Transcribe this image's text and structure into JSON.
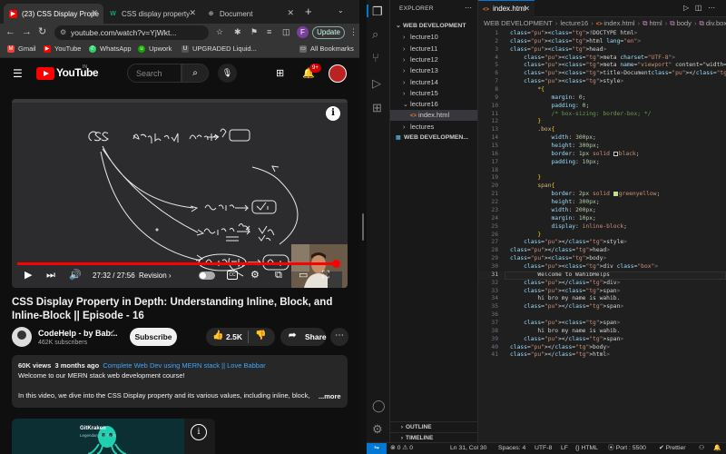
{
  "browser": {
    "tabs": [
      {
        "title": "(23) CSS Display Prope",
        "favicon": "youtube-icon",
        "active": true
      },
      {
        "title": "CSS display property",
        "favicon": "w3schools-icon",
        "active": false
      },
      {
        "title": "Document",
        "favicon": "globe-icon",
        "active": false
      }
    ],
    "url": "youtube.com/watch?v=YjWkt...",
    "update_label": "Update",
    "profile_initial": "F",
    "bookmarks": [
      "Gmail",
      "YouTube",
      "WhatsApp",
      "Upwork",
      "UPGRADED Liquid...",
      "All Bookmarks"
    ]
  },
  "youtube": {
    "logo": "YouTube",
    "region": "IN",
    "search_placeholder": "Search",
    "notification_count": "9+",
    "video": {
      "time": "27:32 / 27:56",
      "chapter": "Revision ›",
      "progress": 0.985
    },
    "title": "CSS Display Property in Depth: Understanding Inline, Block, and Inline-Block || Episode - 16",
    "channel": "CodeHelp - by Bab...",
    "subscribers": "462K subscribers",
    "subscribe_label": "Subscribe",
    "likes": "2.5K",
    "share_label": "Share",
    "description": {
      "views": "60K views",
      "age": "3 months ago",
      "playlist": "Complete Web Dev using MERN stack || Love Babbar",
      "line1": "Welcome to our MERN stack web development course!",
      "line2": "In this video, we dive into the CSS Display property and its various values, including inline, block,",
      "more": "...more"
    },
    "ad": {
      "brand": "GitKraken",
      "tagline": "Legendary Git Tools"
    }
  },
  "vscode": {
    "explorer_title": "EXPLORER",
    "workspace": "WEB DEVELOPMENT",
    "tree": [
      {
        "label": "WEB DEVELOPMENT",
        "type": "folder-open",
        "indent": 0
      },
      {
        "label": "lecture10",
        "type": "folder",
        "indent": 1
      },
      {
        "label": "lecture11",
        "type": "folder",
        "indent": 1
      },
      {
        "label": "lecture12",
        "type": "folder",
        "indent": 1
      },
      {
        "label": "lecture13",
        "type": "folder",
        "indent": 1
      },
      {
        "label": "lecture14",
        "type": "folder",
        "indent": 1
      },
      {
        "label": "lecture15",
        "type": "folder",
        "indent": 1
      },
      {
        "label": "lecture16",
        "type": "folder-open",
        "indent": 1
      },
      {
        "label": "index.html",
        "type": "html-file",
        "indent": 2,
        "selected": true
      },
      {
        "label": "lectures",
        "type": "folder",
        "indent": 1
      },
      {
        "label": "WEB DEVELOPMEN...",
        "type": "workspace-file",
        "indent": 0
      }
    ],
    "outline_label": "OUTLINE",
    "timeline_label": "TIMELINE",
    "tab": "index.html",
    "breadcrumbs": [
      "WEB DEVELOPMENT",
      "lecture16",
      "index.html",
      "html",
      "body",
      "div.box"
    ],
    "cursor_line": 31,
    "code": [
      "<!DOCTYPE html>",
      "<html lang=\"en\">",
      "<head>",
      "    <meta charset=\"UTF-8\">",
      "    <meta name=\"viewport\" content=\"width=device-width",
      "    <title>Document</title>",
      "    <style>",
      "        *{",
      "            margin: 0;",
      "            padding: 0;",
      "            /* box-sizing: border-box; */",
      "        }",
      "        .box{",
      "            width: 300px;",
      "            height: 300px;",
      "            border: 1px solid black;",
      "            padding: 10px;",
      "",
      "        }",
      "        span{",
      "            border: 2px solid greenyellow;",
      "            height: 300px;",
      "            width: 200px;",
      "            margin: 10px;",
      "            display: inline-block;",
      "        }",
      "    </style>",
      "</head>",
      "<body>",
      "    <div class=\"box\">",
      "        Welcome to WahibHelps",
      "    </div>",
      "    <span>",
      "        hi bro my name is wahib.",
      "    </span>",
      "",
      "    <span>",
      "        hi bro my name is wahib.",
      "    </span>",
      "</body>",
      "</html>"
    ],
    "status": {
      "errors": "0",
      "warnings": "0",
      "position": "Ln 31, Col 30",
      "spaces": "Spaces: 4",
      "encoding": "UTF-8",
      "eol": "LF",
      "language": "HTML",
      "port": "Port : 5500",
      "formatter": "Prettier"
    },
    "colors": {
      "accent": "#0078d4",
      "editor_bg": "#1f1f1f"
    }
  }
}
